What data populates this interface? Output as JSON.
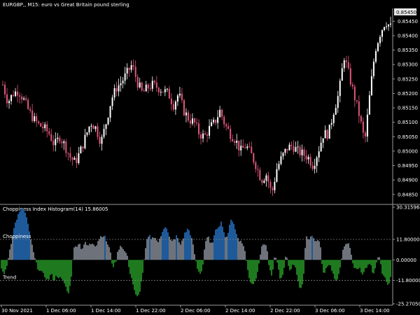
{
  "chart_data": [
    {
      "type": "candlestick",
      "title": "EURGBP,, M15:  euro vs Great Britain pound sterling",
      "current_price": "0.85450",
      "y_tick_labels": [
        "0.85450",
        "0.85400",
        "0.85350",
        "0.85300",
        "0.85250",
        "0.85200",
        "0.85150",
        "0.85100",
        "0.85050",
        "0.85000",
        "0.84950",
        "0.84900",
        "0.84850"
      ],
      "ylim": [
        0.8483,
        0.8548
      ],
      "close_path": [
        0.8523,
        0.8517,
        0.852,
        0.8521,
        0.8518,
        0.8514,
        0.8511,
        0.8509,
        0.8508,
        0.8506,
        0.8502,
        0.8505,
        0.8502,
        0.8498,
        0.8496,
        0.85,
        0.8505,
        0.851,
        0.8508,
        0.8503,
        0.851,
        0.8518,
        0.8522,
        0.8524,
        0.8527,
        0.853,
        0.8524,
        0.852,
        0.8522,
        0.8523,
        0.8522,
        0.8521,
        0.852,
        0.8516,
        0.852,
        0.8514,
        0.8511,
        0.851,
        0.8506,
        0.8505,
        0.8508,
        0.851,
        0.8514,
        0.8509,
        0.8506,
        0.8504,
        0.85,
        0.8502,
        0.8499,
        0.8495,
        0.849,
        0.8492,
        0.8485,
        0.8494,
        0.8498,
        0.8501,
        0.8502,
        0.85,
        0.8499,
        0.8498,
        0.8495,
        0.85,
        0.8506,
        0.8506,
        0.8514,
        0.852,
        0.8533,
        0.8526,
        0.8519,
        0.8512,
        0.8503,
        0.852,
        0.8535,
        0.8541,
        0.8545,
        0.8543
      ]
    },
    {
      "type": "bar",
      "title": "Choppiness Index Histogram(14) 15.86005",
      "y_tick_labels": [
        "30.31596",
        "11.80000",
        "0.00000",
        "-11.80000",
        "-25.27050"
      ],
      "ylim": [
        -25.2705,
        30.31596
      ],
      "levels": [
        {
          "label": "Choppiness",
          "value": 11.8
        },
        {
          "label": "Trend",
          "value": -11.8
        }
      ],
      "colors": {
        "strong": "#1e5a9a",
        "neutral": "#6e737b",
        "trend": "#1f7a1f"
      },
      "profile": [
        [
          0,
          -4
        ],
        [
          4,
          -8
        ],
        [
          8,
          -6
        ],
        [
          12,
          4
        ],
        [
          16,
          12
        ],
        [
          20,
          20
        ],
        [
          24,
          25
        ],
        [
          28,
          28
        ],
        [
          32,
          30
        ],
        [
          36,
          26
        ],
        [
          40,
          18
        ],
        [
          44,
          10
        ],
        [
          48,
          2
        ],
        [
          52,
          -4
        ],
        [
          56,
          -6
        ],
        [
          60,
          -8
        ],
        [
          64,
          -10
        ],
        [
          68,
          -12
        ],
        [
          72,
          -8
        ],
        [
          76,
          -12
        ],
        [
          80,
          -9
        ],
        [
          84,
          -10
        ],
        [
          88,
          -12
        ],
        [
          92,
          -14
        ],
        [
          96,
          -20
        ],
        [
          100,
          -14
        ],
        [
          104,
          6
        ],
        [
          108,
          8
        ],
        [
          112,
          10
        ],
        [
          116,
          6
        ],
        [
          120,
          10
        ],
        [
          124,
          8
        ],
        [
          128,
          9
        ],
        [
          132,
          10
        ],
        [
          136,
          8
        ],
        [
          140,
          12
        ],
        [
          144,
          14
        ],
        [
          148,
          14
        ],
        [
          152,
          10
        ],
        [
          156,
          6
        ],
        [
          160,
          -4
        ],
        [
          164,
          -2
        ],
        [
          168,
          6
        ],
        [
          172,
          9
        ],
        [
          176,
          5
        ],
        [
          180,
          4
        ],
        [
          184,
          -6
        ],
        [
          188,
          -12
        ],
        [
          192,
          -20
        ],
        [
          196,
          -22
        ],
        [
          200,
          -16
        ],
        [
          204,
          -4
        ],
        [
          208,
          10
        ],
        [
          212,
          14
        ],
        [
          216,
          12
        ],
        [
          220,
          14
        ],
        [
          224,
          10
        ],
        [
          228,
          12
        ],
        [
          232,
          18
        ],
        [
          236,
          20
        ],
        [
          240,
          14
        ],
        [
          244,
          10
        ],
        [
          248,
          12
        ],
        [
          252,
          14
        ],
        [
          256,
          8
        ],
        [
          260,
          12
        ],
        [
          264,
          16
        ],
        [
          268,
          18
        ],
        [
          272,
          14
        ],
        [
          276,
          6
        ],
        [
          280,
          -4
        ],
        [
          284,
          -8
        ],
        [
          288,
          -6
        ],
        [
          292,
          10
        ],
        [
          296,
          14
        ],
        [
          300,
          8
        ],
        [
          304,
          12
        ],
        [
          308,
          18
        ],
        [
          312,
          20
        ],
        [
          316,
          22
        ],
        [
          320,
          14
        ],
        [
          324,
          12
        ],
        [
          328,
          24
        ],
        [
          332,
          22
        ],
        [
          336,
          16
        ],
        [
          340,
          12
        ],
        [
          344,
          10
        ],
        [
          348,
          8
        ],
        [
          352,
          -4
        ],
        [
          356,
          -12
        ],
        [
          360,
          -14
        ],
        [
          364,
          -12
        ],
        [
          368,
          -4
        ],
        [
          372,
          6
        ],
        [
          376,
          10
        ],
        [
          380,
          8
        ],
        [
          384,
          -6
        ],
        [
          388,
          -10
        ],
        [
          392,
          4
        ],
        [
          396,
          -4
        ],
        [
          400,
          -12
        ],
        [
          404,
          -8
        ],
        [
          408,
          4
        ],
        [
          412,
          -6
        ],
        [
          416,
          -4
        ],
        [
          420,
          -2
        ],
        [
          424,
          -10
        ],
        [
          428,
          -18
        ],
        [
          432,
          -14
        ],
        [
          436,
          14
        ],
        [
          440,
          12
        ],
        [
          444,
          14
        ],
        [
          448,
          12
        ],
        [
          452,
          10
        ],
        [
          456,
          12
        ],
        [
          460,
          -8
        ],
        [
          464,
          -6
        ],
        [
          468,
          -2
        ],
        [
          472,
          -4
        ],
        [
          476,
          -10
        ],
        [
          480,
          -14
        ],
        [
          484,
          -6
        ],
        [
          488,
          4
        ],
        [
          492,
          8
        ],
        [
          496,
          10
        ],
        [
          500,
          6
        ],
        [
          504,
          -4
        ],
        [
          508,
          -6
        ],
        [
          512,
          -4
        ],
        [
          516,
          -8
        ],
        [
          520,
          -6
        ],
        [
          524,
          -4
        ],
        [
          528,
          -2
        ],
        [
          532,
          -10
        ],
        [
          536,
          -4
        ],
        [
          540,
          4
        ],
        [
          544,
          -6
        ],
        [
          548,
          -10
        ],
        [
          552,
          -14
        ],
        [
          556,
          -12
        ],
        [
          558,
          -8
        ]
      ]
    }
  ],
  "x_tick_labels": [
    "30 Nov 2021",
    "1 Dec 06:00",
    "1 Dec 14:00",
    "1 Dec 22:00",
    "2 Dec 06:00",
    "2 Dec 14:00",
    "2 Dec 22:00",
    "3 Dec 06:00",
    "3 Dec 14:00"
  ],
  "colors": {
    "background": "#000000",
    "candle": "#ffffff",
    "candle_alt": "#e0577a",
    "grid_dotted": "#808080",
    "axis": "#9a9a9a",
    "price_tag_bg": "#e6e6e6"
  }
}
